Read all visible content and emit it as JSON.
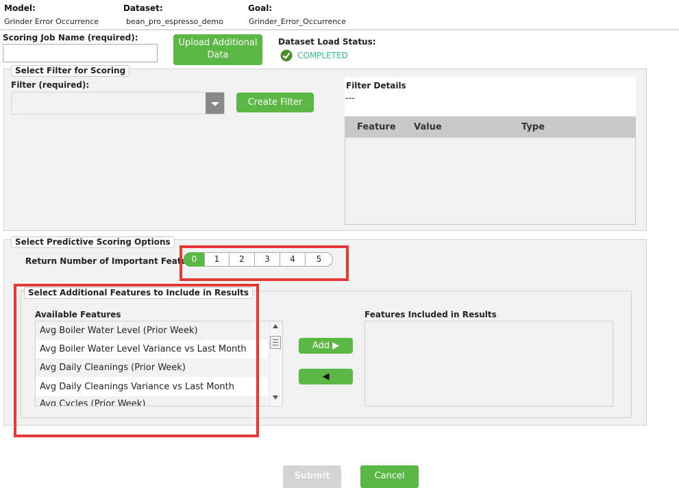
{
  "header": {
    "model_label": "Model:",
    "model_value": "Grinder Error Occurrence",
    "dataset_label": "Dataset:",
    "dataset_value": "bean_pro_espresso_demo",
    "goal_label": "Goal:",
    "goal_value": "Grinder_Error_Occurrence"
  },
  "job": {
    "name_label": "Scoring Job Name (required):",
    "name_value": "",
    "upload_button": "Upload Additional Data",
    "status_label": "Dataset Load Status:",
    "status_value": "COMPLETED",
    "status_color": "#2ebf8e"
  },
  "filter_section": {
    "legend": "Select Filter for Scoring",
    "filter_label": "Filter (required):",
    "filter_value": "",
    "create_button": "Create Filter",
    "details_title": "Filter Details",
    "details_value": "---",
    "columns": [
      "Feature",
      "Value",
      "Type"
    ]
  },
  "predictive_section": {
    "legend": "Select Predictive Scoring Options",
    "return_label": "Return Number of Important Features:",
    "options": [
      "0",
      "1",
      "2",
      "3",
      "4",
      "5"
    ],
    "selected": "0"
  },
  "additional_section": {
    "legend": "Select Additional Features to Include in Results",
    "available_label": "Available Features",
    "included_label": "Features Included in Results",
    "available_items": [
      "Avg Boiler Water Level (Prior Week)",
      "Avg Boiler Water Level Variance vs Last Month",
      "Avg Daily Cleanings (Prior Week)",
      "Avg Daily Cleanings Variance vs Last Month",
      "Avg Cycles (Prior Week)"
    ],
    "add_button": "Add ▶",
    "remove_button": "◀"
  },
  "footer": {
    "submit": "Submit",
    "cancel": "Cancel"
  },
  "colors": {
    "accent_green": "#5cb844",
    "highlight_red": "#e53935",
    "disabled_gray": "#d4d4d4"
  }
}
